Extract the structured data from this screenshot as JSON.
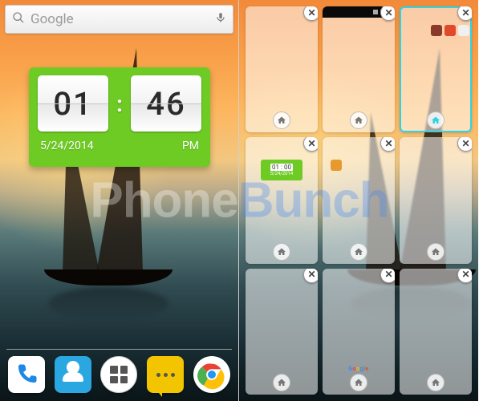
{
  "watermark": {
    "part1": "Phone",
    "part2": "Bunch"
  },
  "left_screen": {
    "search": {
      "brand": "Google",
      "placeholder": ""
    },
    "clock": {
      "hour": "01",
      "minute": "46",
      "date": "5/24/2014",
      "ampm": "PM"
    },
    "dock": {
      "phone": "Phone",
      "contacts": "Contacts",
      "apps": "Apps",
      "sms": "Messaging",
      "chrome": "Chrome"
    }
  },
  "right_screen": {
    "close_glyph": "✕",
    "mini_clock": {
      "time": "01 : 00",
      "date": "5/24/2014"
    },
    "pages": [
      {
        "id": 0,
        "has_status_bar": false,
        "selected": false
      },
      {
        "id": 1,
        "has_status_bar": true,
        "selected": false
      },
      {
        "id": 2,
        "has_status_bar": false,
        "selected": true
      },
      {
        "id": 3,
        "has_status_bar": false,
        "selected": false
      },
      {
        "id": 4,
        "has_status_bar": false,
        "selected": false
      },
      {
        "id": 5,
        "has_status_bar": false,
        "selected": false
      },
      {
        "id": 6,
        "has_status_bar": false,
        "selected": false
      },
      {
        "id": 7,
        "has_status_bar": false,
        "selected": false
      },
      {
        "id": 8,
        "has_status_bar": false,
        "selected": false
      }
    ]
  }
}
